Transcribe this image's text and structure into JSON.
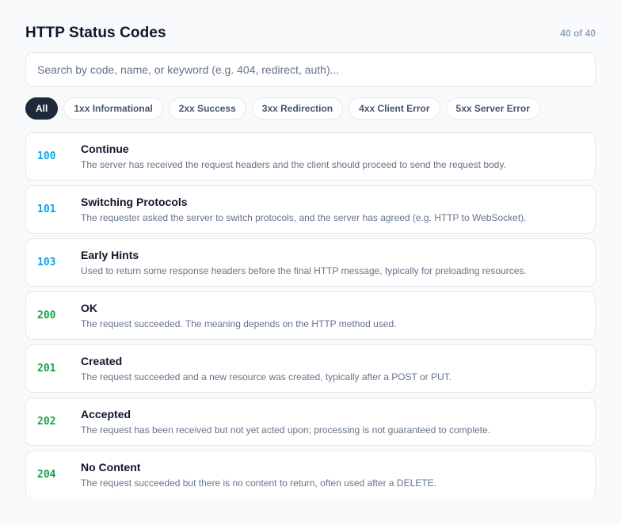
{
  "header": {
    "title": "HTTP Status Codes",
    "count": "40 of 40"
  },
  "search": {
    "placeholder": "Search by code, name, or keyword (e.g. 404, redirect, auth)...",
    "value": ""
  },
  "filters": [
    {
      "label": "All",
      "active": true
    },
    {
      "label": "1xx Informational",
      "active": false
    },
    {
      "label": "2xx Success",
      "active": false
    },
    {
      "label": "3xx Redirection",
      "active": false
    },
    {
      "label": "4xx Client Error",
      "active": false
    },
    {
      "label": "5xx Server Error",
      "active": false
    }
  ],
  "colors": {
    "info": "#0ea5e9",
    "success": "#16a34a",
    "active_chip": "#1e293b"
  },
  "codes": [
    {
      "code": "100",
      "name": "Continue",
      "desc": "The server has received the request headers and the client should proceed to send the request body.",
      "class": "info"
    },
    {
      "code": "101",
      "name": "Switching Protocols",
      "desc": "The requester asked the server to switch protocols, and the server has agreed (e.g. HTTP to WebSocket).",
      "class": "info"
    },
    {
      "code": "103",
      "name": "Early Hints",
      "desc": "Used to return some response headers before the final HTTP message, typically for preloading resources.",
      "class": "info"
    },
    {
      "code": "200",
      "name": "OK",
      "desc": "The request succeeded. The meaning depends on the HTTP method used.",
      "class": "success"
    },
    {
      "code": "201",
      "name": "Created",
      "desc": "The request succeeded and a new resource was created, typically after a POST or PUT.",
      "class": "success"
    },
    {
      "code": "202",
      "name": "Accepted",
      "desc": "The request has been received but not yet acted upon; processing is not guaranteed to complete.",
      "class": "success"
    },
    {
      "code": "204",
      "name": "No Content",
      "desc": "The request succeeded but there is no content to return, often used after a DELETE.",
      "class": "success"
    }
  ]
}
